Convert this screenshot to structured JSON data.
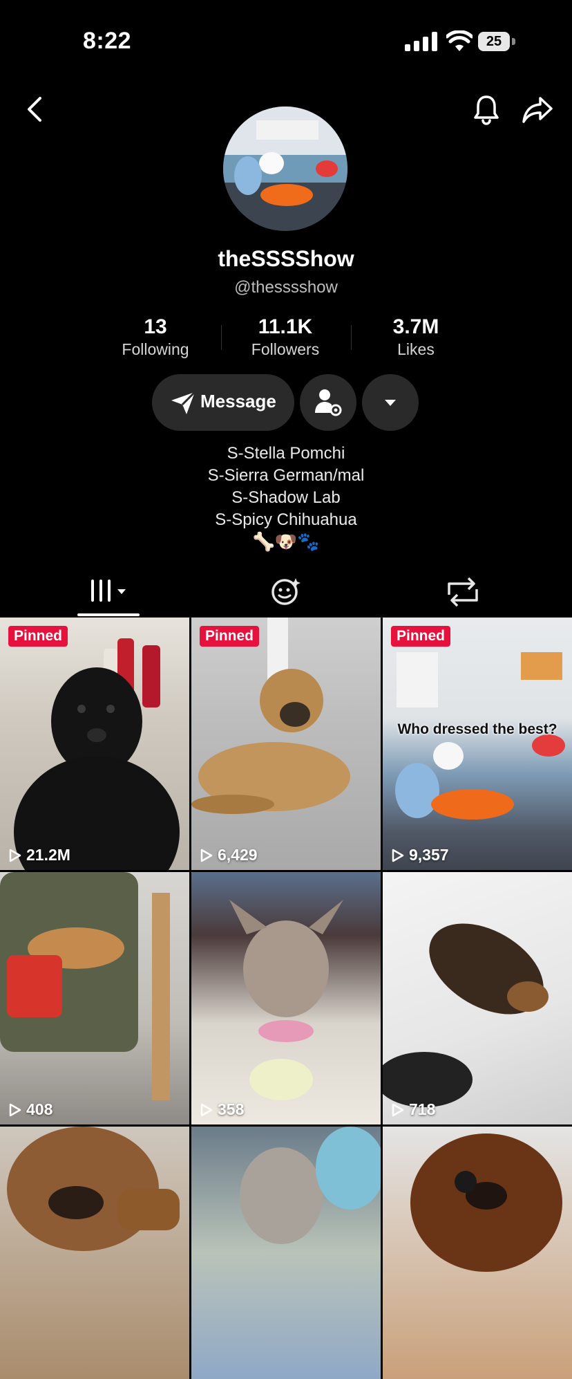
{
  "status": {
    "time": "8:22",
    "battery": "25"
  },
  "colors": {
    "accent_pinned": "#e6113d",
    "button_bg": "#2a2a2a",
    "background": "#000000"
  },
  "topnav": {
    "back_icon": "chevron-left-icon",
    "bell_icon": "bell-icon",
    "share_icon": "share-arrow-icon"
  },
  "profile": {
    "display_name": "theSSSShow",
    "handle": "@thesssshow",
    "stats": [
      {
        "value": "13",
        "label": "Following"
      },
      {
        "value": "11.1K",
        "label": "Followers"
      },
      {
        "value": "3.7M",
        "label": "Likes"
      }
    ],
    "message_label": "Message",
    "bio_lines": [
      "S-Stella Pomchi",
      "S-Sierra German/mal",
      "S-Shadow Lab",
      "S-Spicy Chihuahua"
    ],
    "bio_emoji": "🦴🐶🐾"
  },
  "tabs": [
    {
      "name": "videos",
      "icon": "grid-columns-icon",
      "active": true
    },
    {
      "name": "favorites",
      "icon": "sparkle-face-icon",
      "active": false
    },
    {
      "name": "reposts",
      "icon": "repost-icon",
      "active": false
    }
  ],
  "videos": [
    {
      "pinned_label": "Pinned",
      "views": "21.2M",
      "caption": ""
    },
    {
      "pinned_label": "Pinned",
      "views": "6,429",
      "caption": ""
    },
    {
      "pinned_label": "Pinned",
      "views": "9,357",
      "caption": "Who dressed the best?"
    },
    {
      "pinned_label": "",
      "views": "408",
      "caption": ""
    },
    {
      "pinned_label": "",
      "views": "358",
      "caption": ""
    },
    {
      "pinned_label": "",
      "views": "718",
      "caption": ""
    },
    {
      "pinned_label": "",
      "views": "",
      "caption": ""
    },
    {
      "pinned_label": "",
      "views": "",
      "caption": ""
    },
    {
      "pinned_label": "",
      "views": "",
      "caption": ""
    }
  ]
}
